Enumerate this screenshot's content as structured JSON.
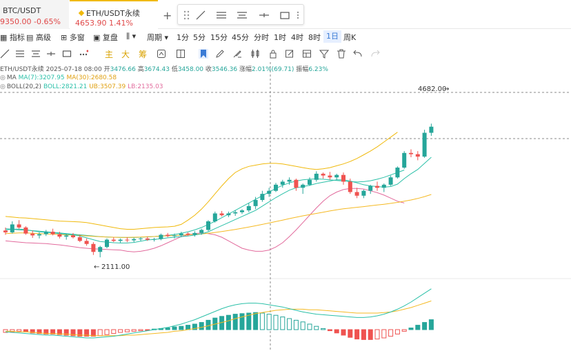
{
  "tabs": [
    {
      "symbol": "BTC/USDT",
      "price": "9350.00",
      "change": "-0.65%"
    },
    {
      "symbol": "ETH/USDT永续",
      "price": "4653.90",
      "change": "1.41%"
    }
  ],
  "toolbar": {
    "indicators": "指标",
    "advanced": "高级",
    "multi_window": "多窗",
    "replay": "复盘",
    "period_label": "周期",
    "periods": [
      "1分",
      "5分",
      "15分",
      "45分",
      "分时",
      "1时",
      "4时",
      "8时",
      "1日",
      "周K"
    ],
    "active_period": "1日",
    "text_tools": [
      "主",
      "大",
      "筹"
    ]
  },
  "legend": {
    "symbol": "ETH/USDT永续",
    "date": "2025-07-18 08:00",
    "open_label": "开",
    "open": "3476.66",
    "high_label": "高",
    "high": "3674.43",
    "low_label": "低",
    "low": "3458.00",
    "close_label": "收",
    "close": "3546.36",
    "change_label": "涨幅",
    "change": "2.01%(69.71)",
    "amp_label": "振幅",
    "amp": "6.23%",
    "ma_name": "MA",
    "ma7": "MA(7):3207.95",
    "ma30": "MA(30):2680.58",
    "boll_name": "BOLL(20,2)",
    "boll_mid": "BOLL:2821.21",
    "boll_ub": "UB:3507.39",
    "boll_lb": "LB:2135.03"
  },
  "annotations": {
    "high_label": "4682.00",
    "low_label": "2111.00"
  },
  "colors": {
    "up": "#26a69a",
    "down": "#ef5350",
    "ma7": "#2bc0a8",
    "ma30": "#f5b922",
    "ub": "#f0b90b",
    "lb": "#e26a9c",
    "mid": "#2bc0a8",
    "active": "#3a7bd5"
  },
  "chart_data": {
    "type": "candlestick",
    "y_range": [
      2000,
      4800
    ],
    "candles": [
      [
        2550,
        2600,
        2480,
        2520
      ],
      [
        2520,
        2700,
        2500,
        2650
      ],
      [
        2650,
        2720,
        2580,
        2600
      ],
      [
        2600,
        2620,
        2480,
        2500
      ],
      [
        2500,
        2550,
        2430,
        2470
      ],
      [
        2470,
        2520,
        2420,
        2490
      ],
      [
        2490,
        2560,
        2460,
        2530
      ],
      [
        2530,
        2580,
        2470,
        2490
      ],
      [
        2490,
        2530,
        2420,
        2450
      ],
      [
        2450,
        2500,
        2400,
        2470
      ],
      [
        2470,
        2510,
        2420,
        2440
      ],
      [
        2440,
        2480,
        2360,
        2380
      ],
      [
        2380,
        2420,
        2300,
        2330
      ],
      [
        2330,
        2360,
        2150,
        2200
      ],
      [
        2200,
        2300,
        2111,
        2280
      ],
      [
        2280,
        2420,
        2260,
        2400
      ],
      [
        2400,
        2440,
        2360,
        2380
      ],
      [
        2380,
        2420,
        2350,
        2400
      ],
      [
        2400,
        2440,
        2360,
        2390
      ],
      [
        2390,
        2430,
        2360,
        2410
      ],
      [
        2410,
        2440,
        2380,
        2420
      ],
      [
        2420,
        2450,
        2380,
        2400
      ],
      [
        2400,
        2430,
        2370,
        2410
      ],
      [
        2410,
        2500,
        2390,
        2480
      ],
      [
        2480,
        2510,
        2440,
        2460
      ],
      [
        2460,
        2500,
        2420,
        2470
      ],
      [
        2470,
        2530,
        2440,
        2500
      ],
      [
        2500,
        2520,
        2460,
        2480
      ],
      [
        2480,
        2540,
        2450,
        2510
      ],
      [
        2510,
        2580,
        2480,
        2560
      ],
      [
        2560,
        2720,
        2540,
        2700
      ],
      [
        2700,
        2860,
        2680,
        2830
      ],
      [
        2830,
        2870,
        2780,
        2800
      ],
      [
        2800,
        2860,
        2770,
        2830
      ],
      [
        2830,
        2880,
        2790,
        2850
      ],
      [
        2850,
        2900,
        2820,
        2880
      ],
      [
        2880,
        3000,
        2850,
        2950
      ],
      [
        2950,
        3100,
        2900,
        3050
      ],
      [
        3050,
        3200,
        3020,
        3150
      ],
      [
        3150,
        3250,
        3100,
        3200
      ],
      [
        3200,
        3330,
        3180,
        3300
      ],
      [
        3300,
        3380,
        3250,
        3350
      ],
      [
        3350,
        3420,
        3300,
        3380
      ],
      [
        3380,
        3400,
        3200,
        3250
      ],
      [
        3250,
        3320,
        3150,
        3300
      ],
      [
        3300,
        3420,
        3280,
        3380
      ],
      [
        3380,
        3520,
        3350,
        3480
      ],
      [
        3480,
        3500,
        3400,
        3450
      ],
      [
        3450,
        3510,
        3380,
        3420
      ],
      [
        3420,
        3480,
        3380,
        3460
      ],
      [
        3460,
        3500,
        3300,
        3350
      ],
      [
        3350,
        3400,
        3150,
        3180
      ],
      [
        3180,
        3250,
        3080,
        3120
      ],
      [
        3120,
        3220,
        3080,
        3200
      ],
      [
        3200,
        3300,
        3150,
        3280
      ],
      [
        3280,
        3350,
        3200,
        3250
      ],
      [
        3250,
        3320,
        3180,
        3300
      ],
      [
        3300,
        3450,
        3280,
        3420
      ],
      [
        3420,
        3600,
        3400,
        3580
      ],
      [
        3580,
        3850,
        3560,
        3820
      ],
      [
        3820,
        3880,
        3750,
        3800
      ],
      [
        3800,
        3850,
        3700,
        3760
      ],
      [
        3760,
        4200,
        3740,
        4150
      ],
      [
        4150,
        4300,
        4100,
        4250
      ]
    ],
    "ma7": [
      2560,
      2570,
      2575,
      2565,
      2545,
      2530,
      2520,
      2510,
      2500,
      2490,
      2480,
      2460,
      2430,
      2400,
      2370,
      2360,
      2350,
      2345,
      2345,
      2355,
      2375,
      2395,
      2405,
      2415,
      2430,
      2440,
      2450,
      2460,
      2475,
      2495,
      2530,
      2580,
      2630,
      2680,
      2730,
      2780,
      2830,
      2880,
      2950,
      3020,
      3090,
      3150,
      3210,
      3250,
      3270,
      3290,
      3320,
      3340,
      3360,
      3380,
      3380,
      3360,
      3330,
      3300,
      3280,
      3270,
      3260,
      3270,
      3310,
      3400,
      3480,
      3550,
      3650,
      3750
    ],
    "ma30": [
      2500,
      2505,
      2510,
      2510,
      2505,
      2500,
      2495,
      2490,
      2485,
      2480,
      2475,
      2470,
      2462,
      2455,
      2448,
      2443,
      2440,
      2438,
      2438,
      2440,
      2443,
      2448,
      2452,
      2458,
      2463,
      2468,
      2474,
      2480,
      2487,
      2495,
      2505,
      2518,
      2533,
      2550,
      2568,
      2587,
      2607,
      2628,
      2650,
      2673,
      2697,
      2720,
      2745,
      2768,
      2790,
      2810,
      2830,
      2850,
      2870,
      2890,
      2905,
      2918,
      2930,
      2942,
      2955,
      2968,
      2980,
      2995,
      3010,
      3030,
      3050,
      3075,
      3105,
      3140
    ],
    "boll_ub": [
      2780,
      2770,
      2760,
      2755,
      2745,
      2735,
      2725,
      2715,
      2705,
      2700,
      2695,
      2690,
      2680,
      2660,
      2640,
      2620,
      2600,
      2580,
      2570,
      2570,
      2580,
      2590,
      2600,
      2605,
      2610,
      2620,
      2650,
      2720,
      2800,
      2900,
      3020,
      3150,
      3280,
      3400,
      3500,
      3560,
      3600,
      3620,
      3640,
      3650,
      3650,
      3640,
      3620,
      3600,
      3580,
      3560,
      3550,
      3560,
      3580,
      3610,
      3640,
      3680,
      3730,
      3790,
      3850,
      3920,
      4000,
      4080,
      4160
    ],
    "boll_mid": [
      2580,
      2570,
      2560,
      2555,
      2548,
      2540,
      2530,
      2520,
      2510,
      2500,
      2490,
      2480,
      2470,
      2460,
      2450,
      2445,
      2440,
      2438,
      2436,
      2436,
      2440,
      2446,
      2452,
      2460,
      2470,
      2485,
      2505,
      2530,
      2560,
      2600,
      2650,
      2700,
      2760,
      2820,
      2880,
      2940,
      3000,
      3060,
      3120,
      3180,
      3240,
      3290,
      3330,
      3360,
      3380,
      3390,
      3395,
      3390,
      3380,
      3370,
      3360,
      3350,
      3345,
      3350,
      3365,
      3390,
      3420,
      3460,
      3500,
      3540
    ],
    "boll_lb": [
      2380,
      2370,
      2360,
      2350,
      2345,
      2340,
      2335,
      2325,
      2315,
      2300,
      2285,
      2270,
      2260,
      2250,
      2245,
      2240,
      2235,
      2230,
      2210,
      2200,
      2210,
      2230,
      2260,
      2300,
      2350,
      2400,
      2450,
      2480,
      2500,
      2510,
      2500,
      2480,
      2440,
      2380,
      2320,
      2260,
      2230,
      2210,
      2210,
      2230,
      2280,
      2350,
      2450,
      2560,
      2680,
      2800,
      2920,
      3030,
      3120,
      3180,
      3220,
      3240,
      3240,
      3230,
      3200,
      3170,
      3130,
      3080,
      3030,
      3000
    ],
    "macd_hist": [
      -5,
      -4,
      -3,
      -4,
      -6,
      -7,
      -8,
      -8,
      -9,
      -10,
      -11,
      -12,
      -12,
      -12,
      -11,
      -9,
      -7,
      -5,
      -4,
      -3,
      -2,
      -1,
      1,
      2,
      3,
      5,
      6,
      8,
      10,
      13,
      17,
      21,
      24,
      26,
      28,
      29,
      30,
      31,
      30,
      28,
      26,
      23,
      20,
      17,
      14,
      10,
      6,
      2,
      -2,
      -6,
      -10,
      -14,
      -17,
      -18,
      -18,
      -17,
      -15,
      -12,
      -8,
      -3,
      3,
      8,
      13,
      18
    ],
    "macd_dif": [
      -4,
      -5,
      -6,
      -7,
      -8,
      -9,
      -10,
      -10,
      -11,
      -12,
      -13,
      -14,
      -15,
      -15,
      -14,
      -13,
      -12,
      -10,
      -8,
      -6,
      -4,
      -2,
      0,
      2,
      4,
      7,
      10,
      14,
      18,
      23,
      28,
      33,
      38,
      42,
      45,
      47,
      48,
      48,
      47,
      45,
      43,
      41,
      38,
      35,
      32,
      30,
      28,
      27,
      26,
      25,
      24,
      23,
      22,
      22,
      23,
      25,
      28,
      32,
      37,
      43,
      50,
      58,
      66,
      74
    ],
    "macd_dea": [
      -3,
      -3,
      -4,
      -4,
      -5,
      -6,
      -7,
      -7,
      -8,
      -8,
      -9,
      -10,
      -10,
      -11,
      -11,
      -11,
      -11,
      -11,
      -10,
      -10,
      -9,
      -8,
      -7,
      -6,
      -5,
      -3,
      -2,
      0,
      2,
      4,
      7,
      10,
      13,
      16,
      20,
      23,
      26,
      29,
      31,
      33,
      35,
      36,
      37,
      37,
      37,
      36,
      36,
      35,
      34,
      33,
      32,
      31,
      30,
      30,
      30,
      30,
      31,
      32,
      34,
      37,
      40,
      44,
      48,
      52
    ]
  }
}
